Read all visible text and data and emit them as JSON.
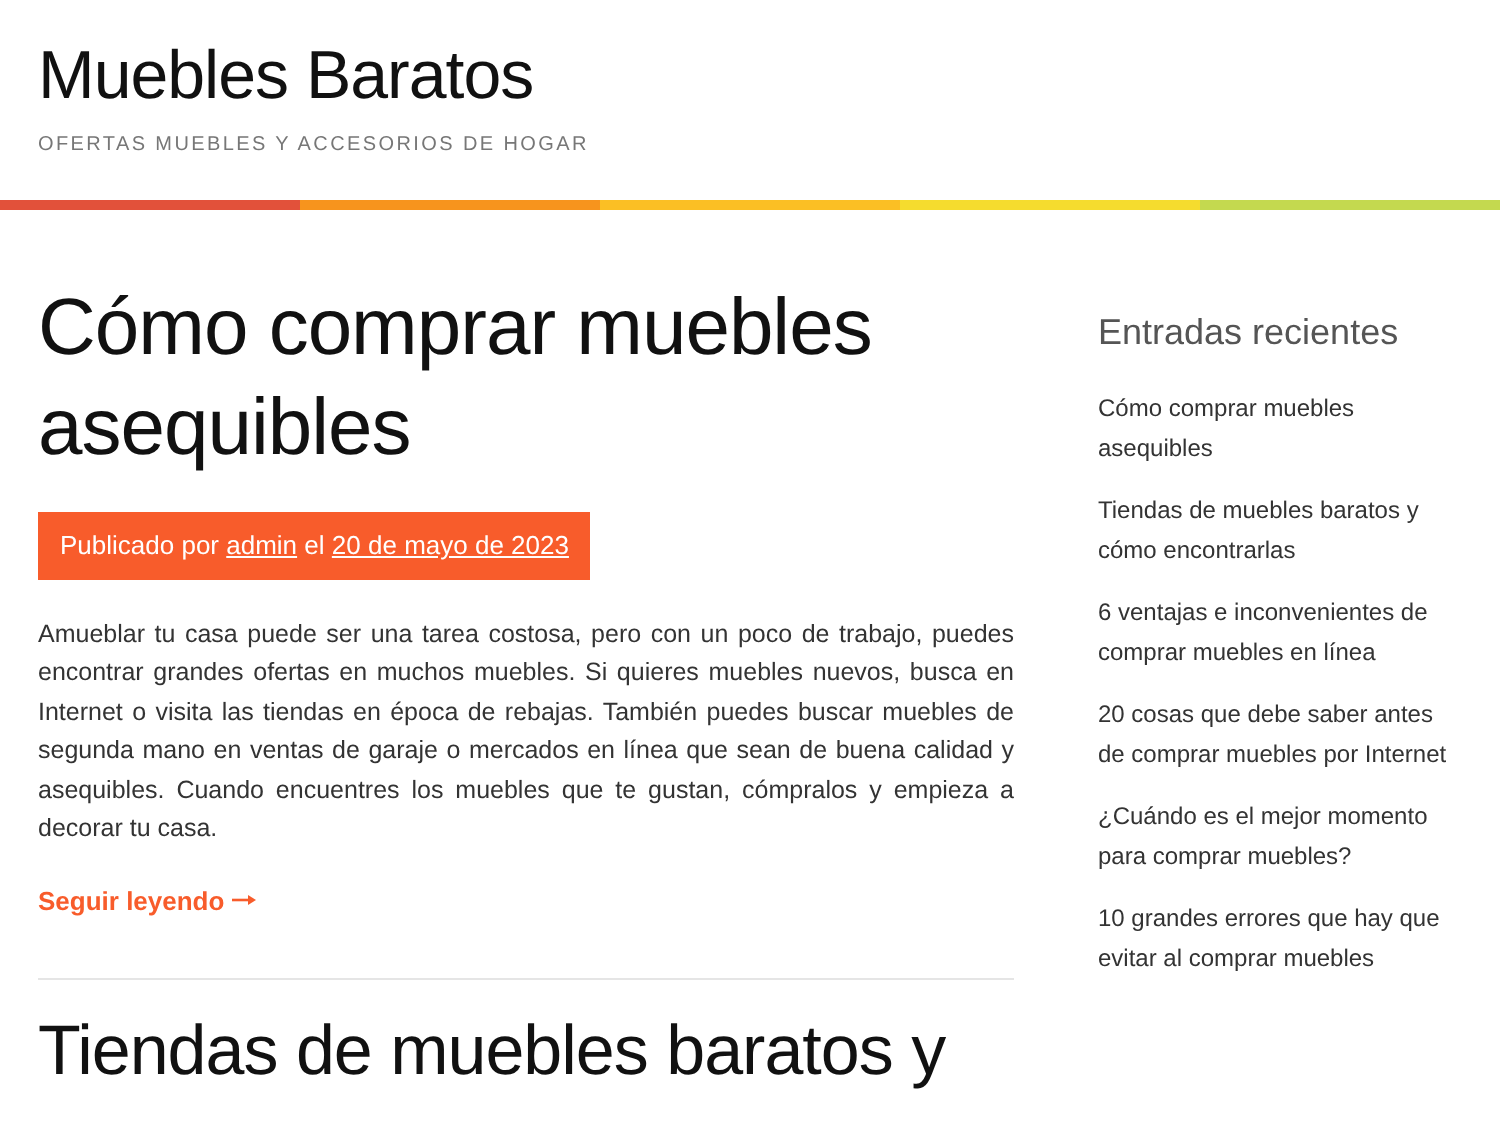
{
  "site": {
    "title": "Muebles Baratos",
    "tagline": "OFERTAS MUEBLES Y ACCESORIOS DE HOGAR"
  },
  "posts": [
    {
      "title": "Cómo comprar muebles asequibles",
      "meta": {
        "prefix": "Publicado por",
        "author": "admin",
        "joiner": "el",
        "date": "20 de mayo de 2023"
      },
      "excerpt": "Amueblar tu casa puede ser una tarea costosa, pero con un poco de trabajo, puedes encontrar grandes ofertas en muchos muebles. Si quieres muebles nuevos, busca en Internet o visita las tiendas en época de rebajas. También puedes buscar muebles de segunda mano en ventas de garaje o mercados en línea que sean de buena calidad y asequibles. Cuando encuentres los muebles que te gustan, cómpralos y empieza a decorar tu casa.",
      "read_more": "Seguir leyendo"
    },
    {
      "title": "Tiendas de muebles baratos y"
    }
  ],
  "sidebar": {
    "heading": "Entradas recientes",
    "items": [
      "Cómo comprar muebles asequibles",
      "Tiendas de muebles baratos y cómo encontrarlas",
      "6 ventajas e inconvenientes de comprar muebles en línea",
      "20 cosas que debe saber antes de comprar muebles por Internet",
      "¿Cuándo es el mejor momento para comprar muebles?",
      "10 grandes errores que hay que evitar al comprar muebles"
    ]
  }
}
